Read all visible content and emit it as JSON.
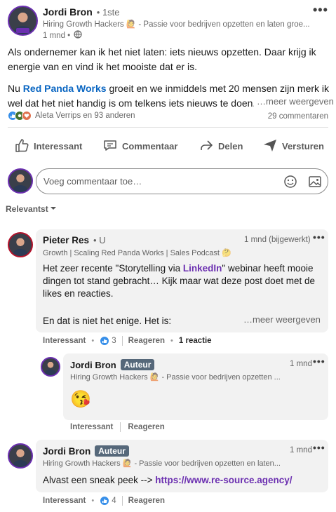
{
  "post": {
    "author": "Jordi Bron",
    "degree": "• 1ste",
    "headline": "Hiring Growth Hackers 🙋 - Passie voor bedrijven opzetten en laten groe...",
    "time": "1 mnd •",
    "text_p1": "Als ondernemer kan ik het niet laten: iets nieuws opzetten. Daar krijg ik energie van en vind ik het mooiste dat er is.",
    "text_p2_pre": "Nu ",
    "text_p2_link": "Red Panda Works",
    "text_p2_post": " groeit en we inmiddels met 20 mensen zijn merk ik wel dat het niet handig is om telkens iets nieuws te doen.",
    "more": "…meer weergeven",
    "reactions_text": "Aleta Verrips en 93 anderen",
    "comments_count": "29 commentaren"
  },
  "actions": {
    "like": "Interessant",
    "comment": "Commentaar",
    "share": "Delen",
    "send": "Versturen"
  },
  "composer": {
    "placeholder": "Voeg commentaar toe…"
  },
  "sort": {
    "label": "Relevantst"
  },
  "comments": [
    {
      "author": "Pieter Res",
      "degree": "• U",
      "headline": "Growth | Scaling Red Panda Works | Sales Podcast 🤔",
      "time": "1 mnd (bijgewerkt)",
      "text_pre": "Het zeer recente \"Storytelling via ",
      "text_link": "LinkedIn",
      "text_post": "\" webinar heeft mooie dingen tot stand gebracht… Kijk maar wat deze post doet met de likes en reacties.",
      "text_2": "En dat is niet het enige. Het is:",
      "more": "…meer weergeven",
      "like": "Interessant",
      "like_count": "3",
      "reply": "Reageren",
      "replies": "1 reactie"
    },
    {
      "author": "Jordi Bron",
      "badge": "Auteur",
      "headline": "Hiring Growth Hackers 🙋 - Passie voor bedrijven opzetten ...",
      "time": "1 mnd",
      "emoji": "😘",
      "like": "Interessant",
      "reply": "Reageren"
    },
    {
      "author": "Jordi Bron",
      "badge": "Auteur",
      "headline": "Hiring Growth Hackers 🙋 - Passie voor bedrijven opzetten en laten...",
      "time": "1 mnd",
      "text_pre": "Alvast een sneak peek --> ",
      "text_link": "https://www.re-source.agency/",
      "like": "Interessant",
      "like_count": "4",
      "reply": "Reageren"
    }
  ]
}
